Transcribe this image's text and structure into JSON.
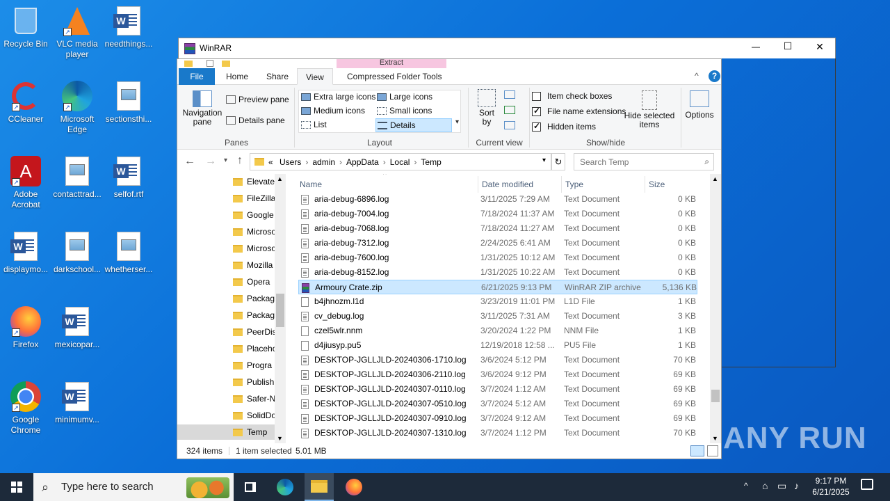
{
  "desktop": {
    "icons": [
      {
        "label": "Recycle Bin",
        "icon": "recycle-bin-icon"
      },
      {
        "label": "VLC media player",
        "icon": "vlc-icon"
      },
      {
        "label": "needthings...",
        "icon": "word-doc-icon"
      },
      {
        "label": "CCleaner",
        "icon": "ccleaner-icon"
      },
      {
        "label": "Microsoft Edge",
        "icon": "edge-icon"
      },
      {
        "label": "sectionsthi...",
        "icon": "image-doc-icon"
      },
      {
        "label": "Adobe Acrobat",
        "icon": "acrobat-icon"
      },
      {
        "label": "contacttrad...",
        "icon": "image-doc-icon"
      },
      {
        "label": "selfof.rtf",
        "icon": "word-doc-icon"
      },
      {
        "label": "displaymo...",
        "icon": "word-doc-icon"
      },
      {
        "label": "darkschool...",
        "icon": "image-doc-icon"
      },
      {
        "label": "whetherser...",
        "icon": "image-doc-icon"
      },
      {
        "label": "Firefox",
        "icon": "firefox-icon"
      },
      {
        "label": "mexicopar...",
        "icon": "word-doc-icon"
      },
      {
        "label": "Google Chrome",
        "icon": "chrome-icon"
      },
      {
        "label": "minimumv...",
        "icon": "word-doc-icon"
      }
    ]
  },
  "winrar": {
    "title": "WinRAR",
    "controls": {
      "minimize": "—",
      "maximize": "☐",
      "close": "✕"
    }
  },
  "explorer": {
    "title_hidden": "Temp",
    "context_tab": "Extract",
    "tabs": [
      "File",
      "Home",
      "Share",
      "View",
      "Compressed Folder Tools"
    ],
    "ribbon": {
      "panes": {
        "navigation_pane": "Navigation pane",
        "preview_pane": "Preview pane",
        "details_pane": "Details pane",
        "label": "Panes"
      },
      "layout": {
        "items": [
          "Extra large icons",
          "Large icons",
          "Medium icons",
          "Small icons",
          "List",
          "Details"
        ],
        "selected": "Details",
        "label": "Layout"
      },
      "current_view": {
        "sort_by": "Sort by",
        "label": "Current view"
      },
      "show_hide": {
        "item_check_boxes": "Item check boxes",
        "file_name_extensions": "File name extensions",
        "hidden_items": "Hidden items",
        "hide_selected": "Hide selected items",
        "label": "Show/hide",
        "checks": {
          "item_check_boxes": false,
          "file_name_extensions": true,
          "hidden_items": true
        }
      },
      "options": "Options"
    },
    "address": {
      "prefix": "«",
      "crumbs": [
        "Users",
        "admin",
        "AppData",
        "Local",
        "Temp"
      ],
      "search_placeholder": "Search Temp"
    },
    "nav_items": [
      "Elevate",
      "FileZilla",
      "Google",
      "Microso",
      "Microso",
      "Mozilla",
      "Opera",
      "Packag",
      "Packag",
      "PeerDis",
      "Placeho",
      "Progra",
      "Publish",
      "Safer-N",
      "SolidDo",
      "Temp"
    ],
    "nav_selected": "Temp",
    "columns": {
      "name": "Name",
      "date": "Date modified",
      "type": "Type",
      "size": "Size"
    },
    "files": [
      {
        "name": "aria-debug-6896.log",
        "date": "3/11/2025 7:29 AM",
        "type": "Text Document",
        "size": "0 KB",
        "icon": "txt"
      },
      {
        "name": "aria-debug-7004.log",
        "date": "7/18/2024 11:37 AM",
        "type": "Text Document",
        "size": "0 KB",
        "icon": "txt"
      },
      {
        "name": "aria-debug-7068.log",
        "date": "7/18/2024 11:27 AM",
        "type": "Text Document",
        "size": "0 KB",
        "icon": "txt"
      },
      {
        "name": "aria-debug-7312.log",
        "date": "2/24/2025 6:41 AM",
        "type": "Text Document",
        "size": "0 KB",
        "icon": "txt"
      },
      {
        "name": "aria-debug-7600.log",
        "date": "1/31/2025 10:12 AM",
        "type": "Text Document",
        "size": "0 KB",
        "icon": "txt"
      },
      {
        "name": "aria-debug-8152.log",
        "date": "1/31/2025 10:22 AM",
        "type": "Text Document",
        "size": "0 KB",
        "icon": "txt"
      },
      {
        "name": "Armoury Crate.zip",
        "date": "6/21/2025 9:13 PM",
        "type": "WinRAR ZIP archive",
        "size": "5,136 KB",
        "icon": "rar",
        "selected": true
      },
      {
        "name": "b4jhnozm.l1d",
        "date": "3/23/2019 11:01 PM",
        "type": "L1D File",
        "size": "1 KB",
        "icon": "blank"
      },
      {
        "name": "cv_debug.log",
        "date": "3/11/2025 7:31 AM",
        "type": "Text Document",
        "size": "3 KB",
        "icon": "txt"
      },
      {
        "name": "czel5wlr.nnm",
        "date": "3/20/2024 1:22 PM",
        "type": "NNM File",
        "size": "1 KB",
        "icon": "blank"
      },
      {
        "name": "d4jiusyp.pu5",
        "date": "12/19/2018 12:58 ...",
        "type": "PU5 File",
        "size": "1 KB",
        "icon": "blank"
      },
      {
        "name": "DESKTOP-JGLLJLD-20240306-1710.log",
        "date": "3/6/2024 5:12 PM",
        "type": "Text Document",
        "size": "70 KB",
        "icon": "txt"
      },
      {
        "name": "DESKTOP-JGLLJLD-20240306-2110.log",
        "date": "3/6/2024 9:12 PM",
        "type": "Text Document",
        "size": "69 KB",
        "icon": "txt"
      },
      {
        "name": "DESKTOP-JGLLJLD-20240307-0110.log",
        "date": "3/7/2024 1:12 AM",
        "type": "Text Document",
        "size": "69 KB",
        "icon": "txt"
      },
      {
        "name": "DESKTOP-JGLLJLD-20240307-0510.log",
        "date": "3/7/2024 5:12 AM",
        "type": "Text Document",
        "size": "69 KB",
        "icon": "txt"
      },
      {
        "name": "DESKTOP-JGLLJLD-20240307-0910.log",
        "date": "3/7/2024 9:12 AM",
        "type": "Text Document",
        "size": "69 KB",
        "icon": "txt"
      },
      {
        "name": "DESKTOP-JGLLJLD-20240307-1310.log",
        "date": "3/7/2024 1:12 PM",
        "type": "Text Document",
        "size": "70 KB",
        "icon": "txt"
      }
    ],
    "status": {
      "count": "324 items",
      "selected": "1 item selected",
      "size": "5.01 MB"
    }
  },
  "taskbar": {
    "search_placeholder": "Type here to search",
    "time": "9:17 PM",
    "date": "6/21/2025"
  },
  "watermark": "ANY RUN"
}
